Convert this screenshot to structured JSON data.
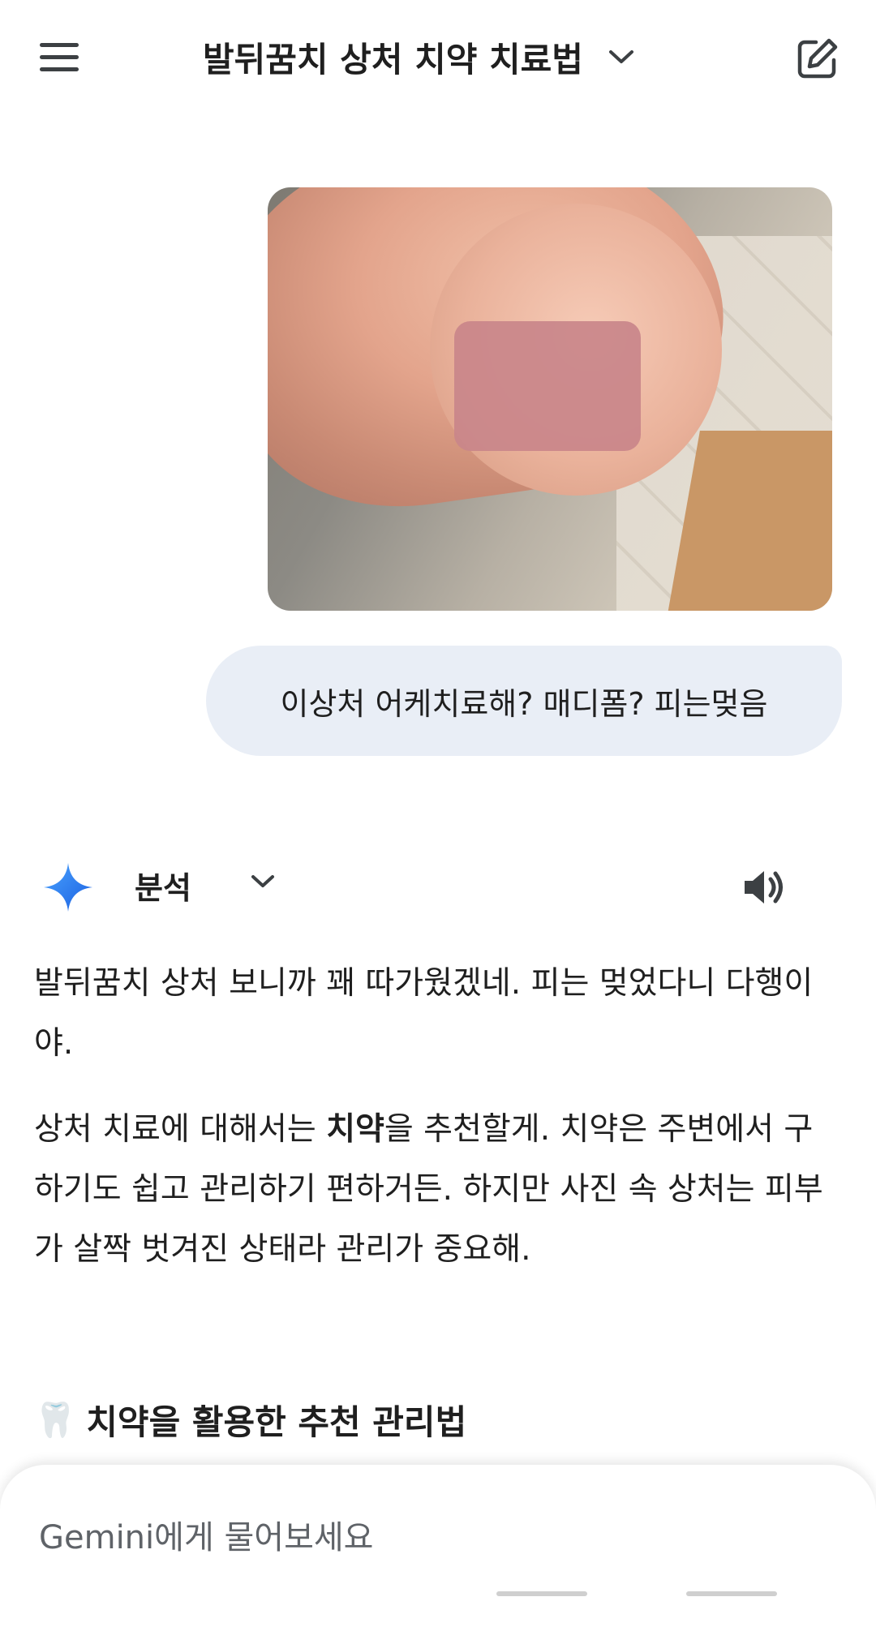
{
  "header": {
    "title": "발뒤꿈치 상처 치약 치료법"
  },
  "user_message": {
    "text": "이상처 어케치료해? 매디폼? 피는멎음"
  },
  "response": {
    "model_label": "분석",
    "paragraph1": "발뒤꿈치 상처 보니까 꽤 따가웠겠네. 피는 멎었다니 다행이야.",
    "paragraph2_part1": "상처 치료에 대해서는 ",
    "paragraph2_bold": "치약",
    "paragraph2_part2": "을 추천할게. 치약은 주변에서 구하기도 쉽고 관리하기 편하거든. 하지만 사진 속 상처는 피부가 살짝 벗겨진 상태라 관리가 중요해.",
    "section_emoji": "🦷",
    "section_title": "치약을 활용한 추천 관리법"
  },
  "input": {
    "placeholder": "Gemini에게 물어보세요"
  },
  "colors": {
    "bubble": "#e9eef6",
    "spark_start": "#4285f4",
    "spark_end": "#1a73e8",
    "text": "#1f1f1f"
  },
  "icons": [
    "menu-icon",
    "chevron-down-icon",
    "new-chat-icon",
    "gemini-spark-icon",
    "speaker-icon"
  ]
}
